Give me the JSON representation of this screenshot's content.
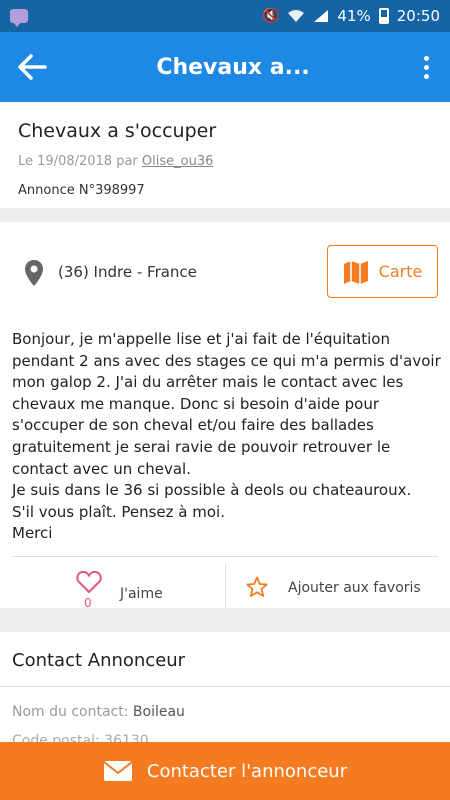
{
  "status_bar": {
    "battery": "41%",
    "time": "20:50",
    "icons": [
      "message-icon",
      "mute-icon",
      "wifi-icon",
      "signal-icon",
      "battery-icon"
    ]
  },
  "app_bar": {
    "title": "Chevaux a...",
    "back_icon": "arrow-left-icon",
    "menu_icon": "more-vertical-icon"
  },
  "ad": {
    "title": "Chevaux a s'occuper",
    "date_prefix": "Le 19/08/2018 par ",
    "author": "Olise_ou36",
    "number": "Annonce N°398997"
  },
  "location": {
    "text": "(36) Indre - France",
    "map_button": "Carte"
  },
  "description": "Bonjour, je m'appelle lise et j'ai fait de l'équitation pendant 2 ans avec des stages ce qui m'a permis d'avoir mon galop 2. J'ai du arrêter mais le contact avec les chevaux me manque. Donc si besoin d'aide pour s'occuper de son cheval et/ou faire des ballades gratuitement je serai ravie de pouvoir retrouver le contact avec un cheval.\nJe suis dans le 36 si possible à deols ou chateauroux.\nS'il vous plaît. Pensez à moi.\nMerci",
  "actions": {
    "like_label": "J'aime",
    "like_count": "0",
    "favorite_label": "Ajouter aux favoris"
  },
  "contact": {
    "section_title": "Contact Annonceur",
    "name_label": "Nom du contact: ",
    "name_value": "Boileau",
    "hidden_line": "Code postal: 36130"
  },
  "cta": {
    "label": "Contacter l'annonceur"
  },
  "colors": {
    "app_bar": "#1e88e5",
    "status_bar": "#1565a6",
    "accent": "#f47b20",
    "heart": "#e05a7a"
  }
}
